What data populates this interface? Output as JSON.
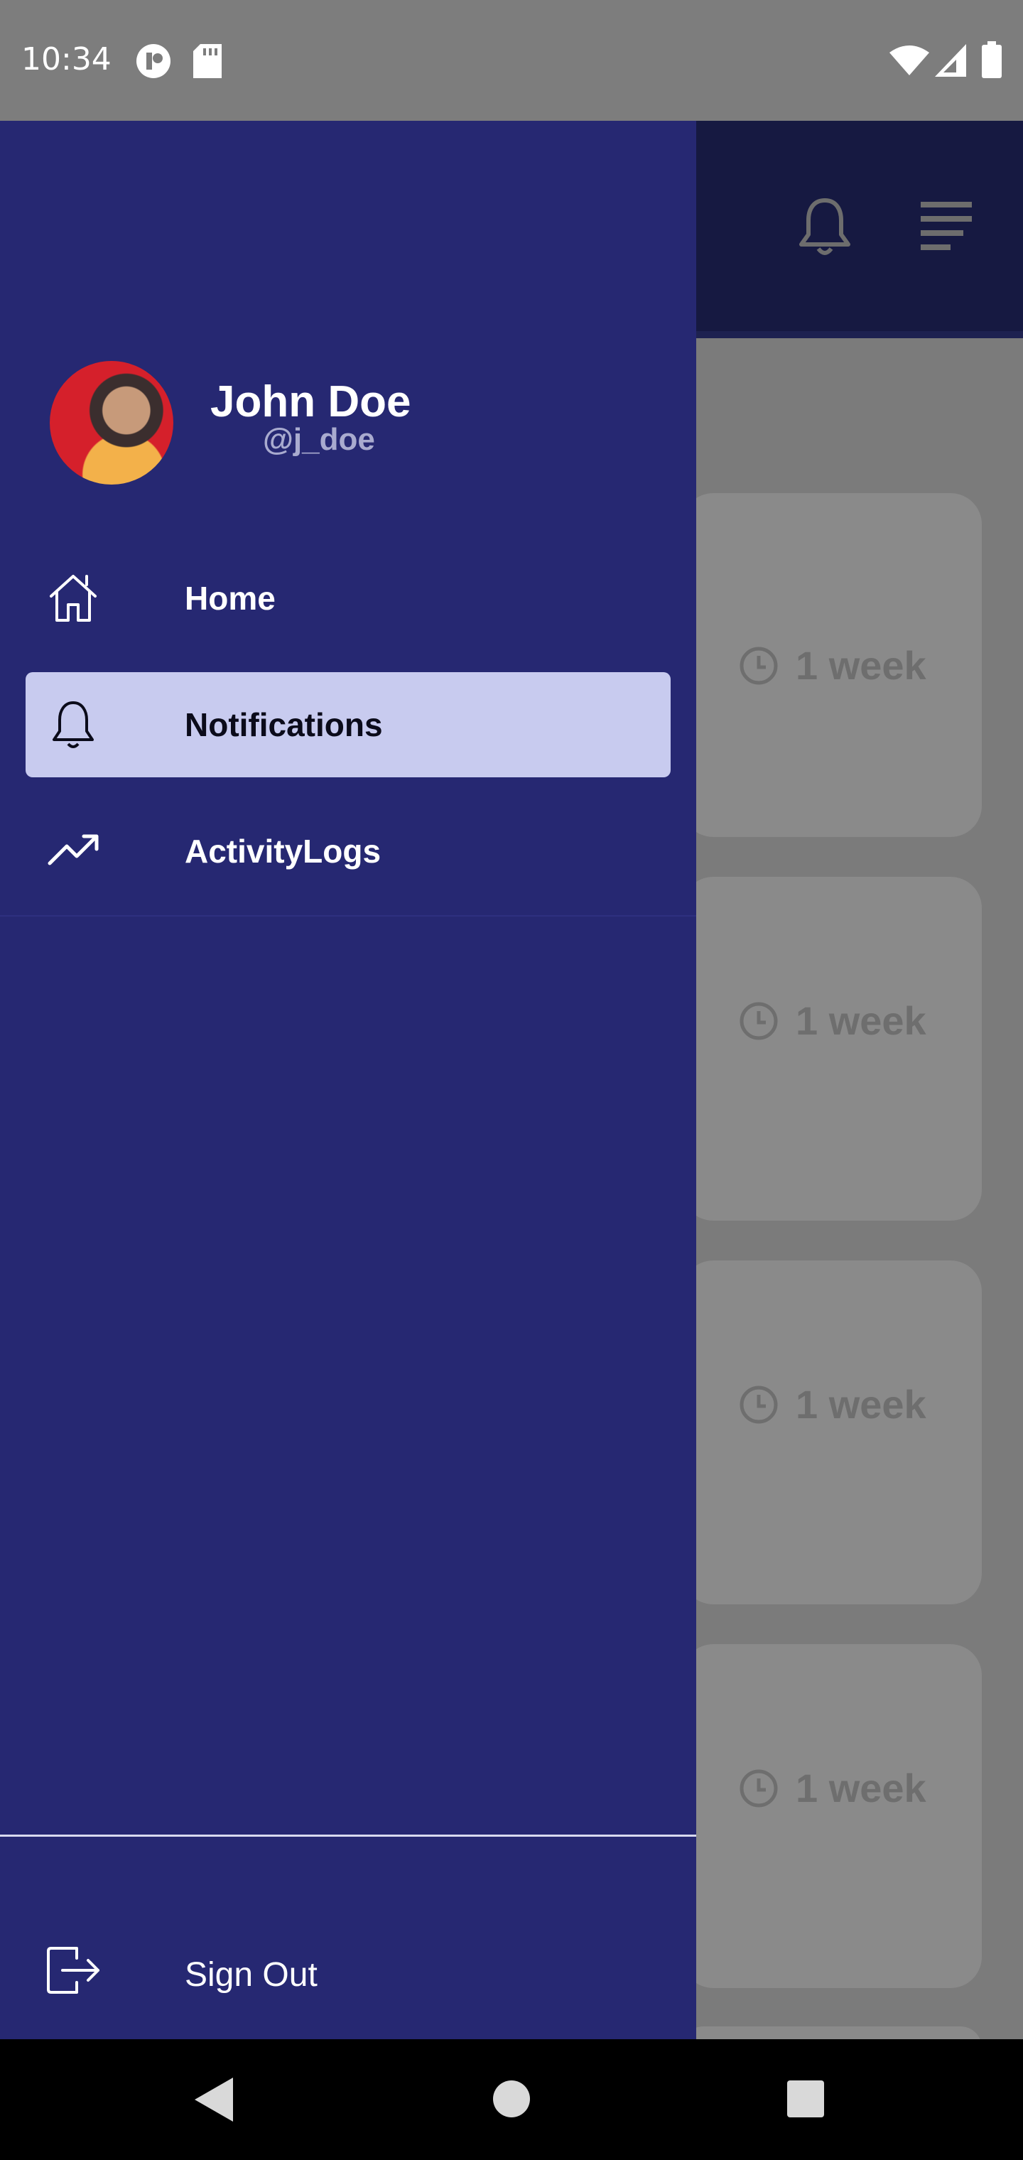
{
  "status_bar": {
    "time": "10:34",
    "left_icons": [
      "app-notification-icon",
      "sd-card-icon"
    ],
    "right_icons": [
      "wifi-icon",
      "signal-icon",
      "battery-icon"
    ]
  },
  "app_bar": {
    "icons": [
      "bell-icon",
      "menu-icon"
    ]
  },
  "drawer": {
    "user": {
      "name": "John Doe",
      "handle": "@j_doe",
      "avatar_icon": "avatar"
    },
    "items": [
      {
        "label": "Home",
        "icon": "home-icon",
        "active": false
      },
      {
        "label": "Notifications",
        "icon": "bell-icon",
        "active": true
      },
      {
        "label": "ActivityLogs",
        "icon": "trending-up-icon",
        "active": false
      }
    ],
    "sign_out": {
      "label": "Sign Out",
      "icon": "logout-icon"
    },
    "colors": {
      "background": "#262872",
      "active_item": "#c8cbef"
    }
  },
  "background_cards": [
    {
      "time": "1 week"
    },
    {
      "time": "1 week"
    },
    {
      "time": "1 week"
    },
    {
      "time": "1 week"
    }
  ],
  "system_nav": {
    "buttons": [
      "back-button",
      "home-button",
      "recents-button"
    ]
  }
}
